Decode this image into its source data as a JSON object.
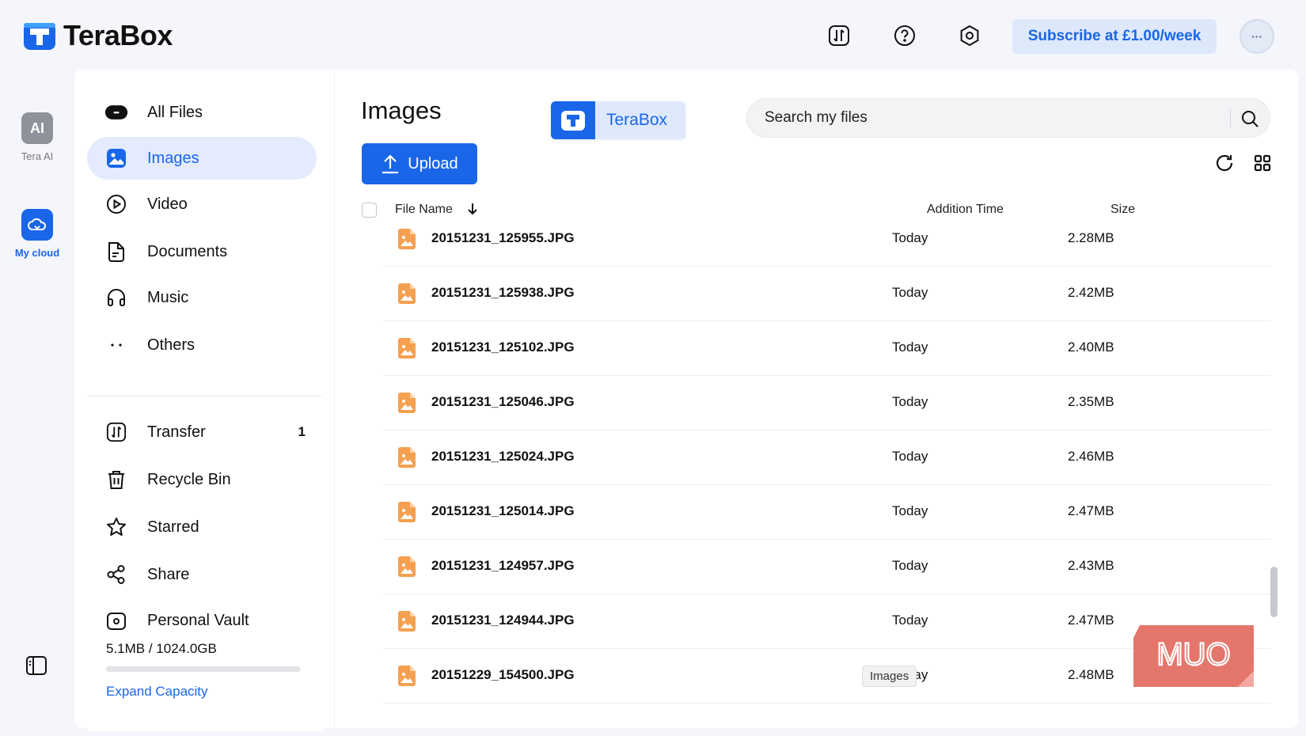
{
  "brand": {
    "name": "TeraBox",
    "primary_color": "#1a66e8",
    "file_icon_color": "#f5a050"
  },
  "topbar": {
    "icons": [
      "transfer-icon",
      "help-icon",
      "settings-icon"
    ],
    "subscribe_label": "Subscribe at £1.00/week",
    "avatar_label": "···"
  },
  "rail": {
    "items": [
      {
        "label": "Tera AI",
        "icon": "ai-icon",
        "tile_text": "AI"
      },
      {
        "label": "My cloud",
        "icon": "cloud-icon",
        "active": true
      }
    ],
    "bottom_icon": "sidebar-toggle-icon"
  },
  "sidebar": {
    "nav": [
      {
        "label": "All Files",
        "icon": "all-files-icon"
      },
      {
        "label": "Images",
        "icon": "images-icon",
        "active": true
      },
      {
        "label": "Video",
        "icon": "video-icon"
      },
      {
        "label": "Documents",
        "icon": "documents-icon"
      },
      {
        "label": "Music",
        "icon": "music-icon"
      },
      {
        "label": "Others",
        "icon": "others-icon"
      }
    ],
    "nav2": [
      {
        "label": "Transfer",
        "icon": "transfer-icon",
        "badge": "1"
      },
      {
        "label": "Recycle Bin",
        "icon": "trash-icon"
      },
      {
        "label": "Starred",
        "icon": "star-icon"
      },
      {
        "label": "Share",
        "icon": "share-icon"
      },
      {
        "label": "Personal Vault",
        "icon": "vault-icon"
      }
    ],
    "storage": {
      "used_text": "5.1MB / 1024.0GB",
      "used_fraction": 5e-06
    },
    "expand_label": "Expand Capacity"
  },
  "main": {
    "title": "Images",
    "chip_label": "TeraBox",
    "search_placeholder": "Search my files",
    "upload_label": "Upload",
    "toolbar_icons": [
      "refresh-icon",
      "grid-view-icon"
    ],
    "columns": {
      "name": "File Name",
      "time": "Addition Time",
      "size": "Size",
      "sort": "descending"
    },
    "files": [
      {
        "name": "20151231_125955.JPG",
        "time": "Today",
        "size": "2.28MB"
      },
      {
        "name": "20151231_125938.JPG",
        "time": "Today",
        "size": "2.42MB"
      },
      {
        "name": "20151231_125102.JPG",
        "time": "Today",
        "size": "2.40MB"
      },
      {
        "name": "20151231_125046.JPG",
        "time": "Today",
        "size": "2.35MB"
      },
      {
        "name": "20151231_125024.JPG",
        "time": "Today",
        "size": "2.46MB"
      },
      {
        "name": "20151231_125014.JPG",
        "time": "Today",
        "size": "2.47MB"
      },
      {
        "name": "20151231_124957.JPG",
        "time": "Today",
        "size": "2.43MB"
      },
      {
        "name": "20151231_124944.JPG",
        "time": "Today",
        "size": "2.47MB"
      },
      {
        "name": "20151229_154500.JPG",
        "time": "Today",
        "size": "2.48MB"
      }
    ],
    "tooltip": "Images"
  },
  "watermark": {
    "text": "MUO",
    "color": "#e36a5e"
  }
}
